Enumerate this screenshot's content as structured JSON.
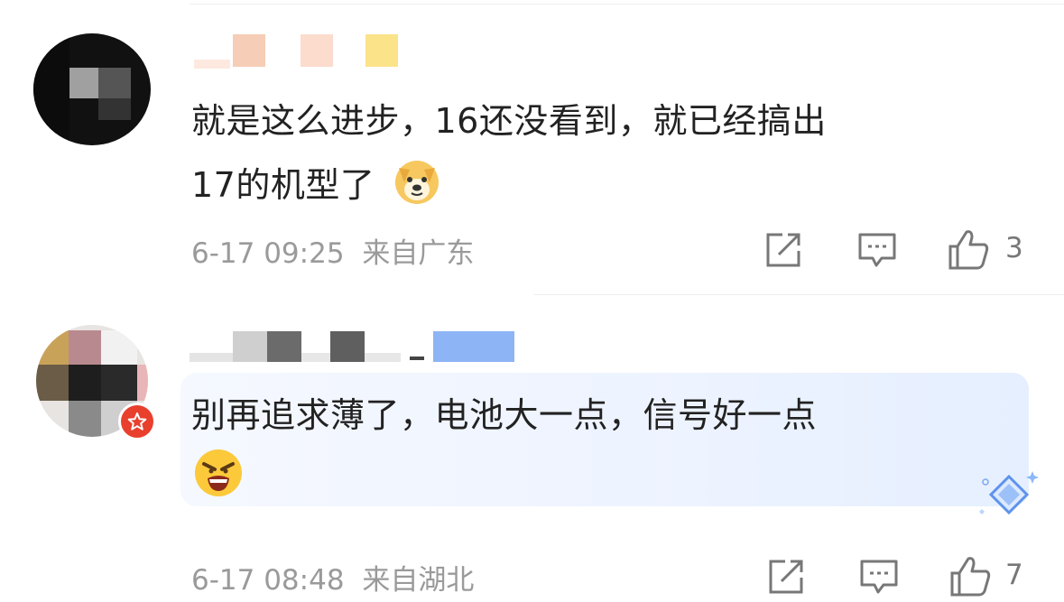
{
  "comments": [
    {
      "text_line1": "就是这么进步，16还没看到，就已经搞出",
      "text_line2": "17的机型了",
      "emoji": "doge-emoji",
      "time": "6-17 09:25",
      "location": "来自广东",
      "likes": "3"
    },
    {
      "text_line1": "别再追求薄了，电池大一点，信号好一点",
      "emoji": "angry-shout-emoji",
      "time": "6-17 08:48",
      "location": "来自湖北",
      "likes": "7"
    }
  ],
  "colors": {
    "text": "#222222",
    "meta": "#9a9a9a",
    "highlight": "#edf3ff",
    "badge": "#e8402d"
  }
}
